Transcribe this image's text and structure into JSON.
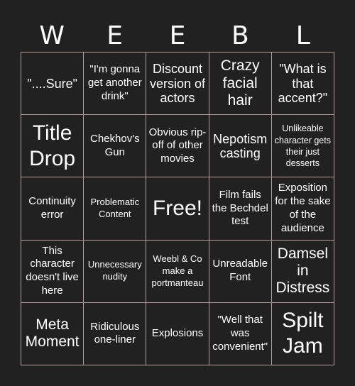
{
  "card": {
    "header_letters": [
      "W",
      "E",
      "E",
      "B",
      "L"
    ],
    "cells": [
      {
        "text": "\"....Sure\"",
        "size": "s-m"
      },
      {
        "text": "\"I'm gonna get another drink\"",
        "size": "s-s"
      },
      {
        "text": "Discount version of actors",
        "size": "s-m"
      },
      {
        "text": "Crazy facial hair",
        "size": "s-l"
      },
      {
        "text": "\"What is that accent?\"",
        "size": "s-m"
      },
      {
        "text": "Title Drop",
        "size": "s-xl"
      },
      {
        "text": "Chekhov's Gun",
        "size": "s-s"
      },
      {
        "text": "Obvious rip-off of other movies",
        "size": "s-s"
      },
      {
        "text": "Nepotism casting",
        "size": "s-m"
      },
      {
        "text": "Unlikeable character gets their just desserts",
        "size": "s-xxs"
      },
      {
        "text": "Continuity error",
        "size": "s-s"
      },
      {
        "text": "Problematic Content",
        "size": "s-xs"
      },
      {
        "text": "Free!",
        "size": "free"
      },
      {
        "text": "Film fails the Bechdel test",
        "size": "s-s"
      },
      {
        "text": "Exposition for the sake of the audience",
        "size": "s-s"
      },
      {
        "text": "This character doesn't live here",
        "size": "s-s"
      },
      {
        "text": "Unnecessary nudity",
        "size": "s-xs"
      },
      {
        "text": "Weebl & Co make a portmanteau",
        "size": "s-xs"
      },
      {
        "text": "Unreadable Font",
        "size": "s-s"
      },
      {
        "text": "Damsel in Distress",
        "size": "s-l"
      },
      {
        "text": "Meta Moment",
        "size": "s-l"
      },
      {
        "text": "Ridiculous one-liner",
        "size": "s-s"
      },
      {
        "text": "Explosions",
        "size": "s-s"
      },
      {
        "text": "\"Well that was convenient\"",
        "size": "s-s"
      },
      {
        "text": "Spilt Jam",
        "size": "s-xl"
      }
    ]
  },
  "colors": {
    "background": "#212121",
    "grid_border": "#b89a9a",
    "text": "#ffffff"
  }
}
